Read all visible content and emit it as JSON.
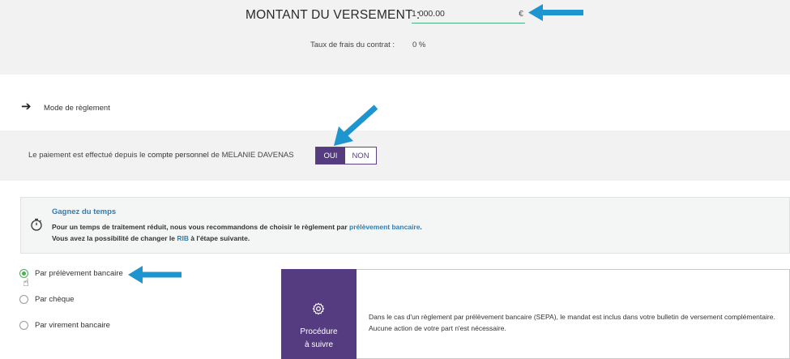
{
  "amount": {
    "label": "MONTANT DU VERSEMENT :",
    "value": "1 000.00",
    "currency": "€",
    "fees_label": "Taux de frais du contrat :",
    "fees_value": "0 %"
  },
  "mode": {
    "label": "Mode de règlement"
  },
  "payment_source": {
    "prefix": "Le paiement est effectué depuis le",
    "account": "compte personnel",
    "suffix": "de MELANIE DAVENAS",
    "yes": "OUI",
    "no": "NON",
    "selected": "OUI"
  },
  "info": {
    "title": "Gagnez du temps",
    "line1_text": "Pour un temps de traitement réduit, nous vous recommandons de choisir le règlement par",
    "line1_link": "prélèvement bancaire",
    "line1_end": ".",
    "line2_text": "Vous avez la possibilité de changer le",
    "line2_link": "RIB",
    "line2_end": "à l'étape suivante."
  },
  "payment_methods": [
    {
      "label": "Par prélèvement bancaire",
      "selected": true
    },
    {
      "label": "Par chèque",
      "selected": false
    },
    {
      "label": "Par virement bancaire",
      "selected": false
    }
  ],
  "procedure": {
    "title_line1": "Procédure",
    "title_line2": "à suivre",
    "text_line1": "Dans le cas d'un règlement par prélèvement bancaire (SEPA), le mandat est inclus dans votre bulletin de versement complémentaire.",
    "text_line2": "Aucune action de votre part n'est nécessaire."
  },
  "colors": {
    "accent_purple": "#553c80",
    "link_blue": "#2a7fb5",
    "radio_green": "#4caf50",
    "annotation_arrow": "#1f95cf"
  }
}
